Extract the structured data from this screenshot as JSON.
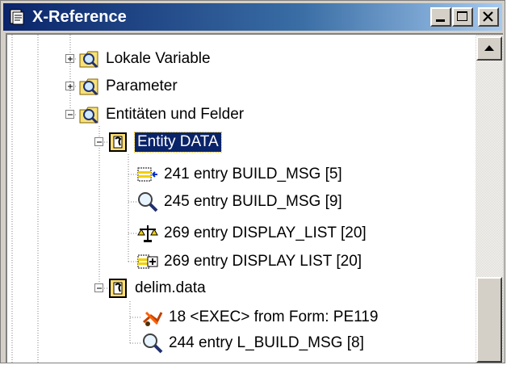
{
  "window": {
    "title": "X-Reference",
    "icons": {
      "app": "document-icon",
      "minimize": "minimize-icon",
      "maximize": "maximize-icon",
      "close": "close-icon"
    }
  },
  "tree": {
    "items": [
      {
        "label": "Lokale Variable",
        "icon": "folder-search-icon",
        "expander": "plus"
      },
      {
        "label": "Parameter",
        "icon": "folder-search-icon",
        "expander": "plus"
      },
      {
        "label": "Entitäten und Felder",
        "icon": "folder-search-icon",
        "expander": "minus"
      },
      {
        "label": "Entity DATA",
        "icon": "entity-icon",
        "expander": "minus",
        "selected": true
      },
      {
        "label": "241 entry BUILD_MSG [5]",
        "icon": "assign-arrow-icon"
      },
      {
        "label": "245 entry BUILD_MSG [9]",
        "icon": "magnifier-icon"
      },
      {
        "label": "269 entry DISPLAY_LIST [20]",
        "icon": "scales-icon"
      },
      {
        "label": "269 entry DISPLAY  LIST [20]",
        "icon": "grid-plus-icon"
      },
      {
        "label": "delim.data",
        "icon": "entity-icon",
        "expander": "minus"
      },
      {
        "label": "18 <EXEC> from Form: PE119",
        "icon": "exec-icon"
      },
      {
        "label": "244 entry L_BUILD_MSG [8]",
        "icon": "magnifier-icon"
      }
    ]
  },
  "scrollbar": {
    "up_icon": "arrow-up-icon"
  }
}
